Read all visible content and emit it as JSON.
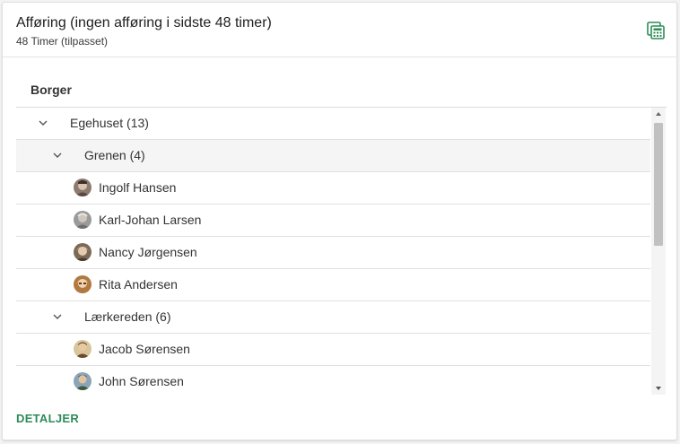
{
  "header": {
    "title": "Afføring (ingen afføring i sidste 48 timer)",
    "subtitle": "48 Timer (tilpasset)",
    "icon": "calculator-icon"
  },
  "table": {
    "column_header": "Borger",
    "rows": [
      {
        "type": "group",
        "level": 0,
        "label": "Egehuset (13)",
        "expanded": true
      },
      {
        "type": "group",
        "level": 1,
        "label": "Grenen (4)",
        "expanded": true
      },
      {
        "type": "person",
        "label": "Ingolf Hansen"
      },
      {
        "type": "person",
        "label": "Karl-Johan Larsen"
      },
      {
        "type": "person",
        "label": "Nancy Jørgensen"
      },
      {
        "type": "person",
        "label": "Rita Andersen"
      },
      {
        "type": "group",
        "level": 1,
        "label": "Lærkereden (6)",
        "expanded": true
      },
      {
        "type": "person",
        "label": "Jacob Sørensen"
      },
      {
        "type": "person",
        "label": "John Sørensen"
      }
    ]
  },
  "footer": {
    "details_label": "DETALJER"
  },
  "colors": {
    "accent": "#2e8b57",
    "divider": "#e0e0e0",
    "selected_row": "#f5f5f5"
  }
}
